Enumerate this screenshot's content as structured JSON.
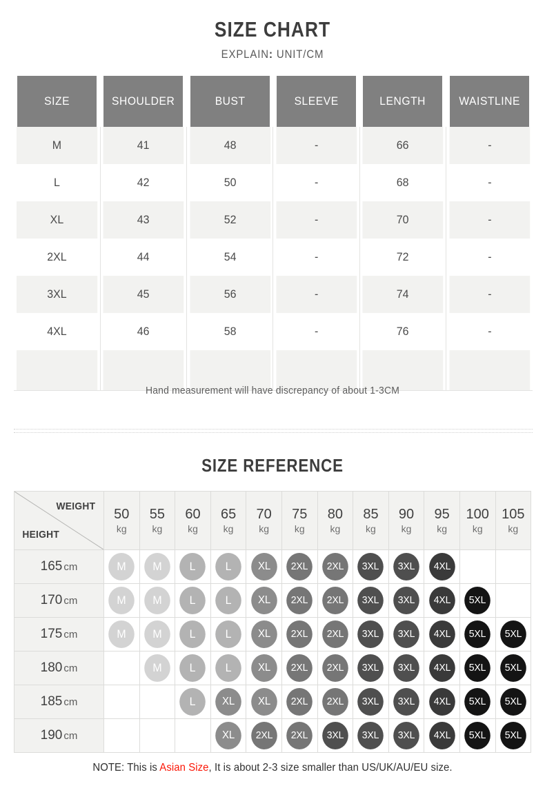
{
  "size_chart": {
    "title": "SIZE CHART",
    "subtitle_label": "EXPLAIN",
    "subtitle_colon": ":",
    "subtitle_value": "UNIT/CM",
    "columns": [
      "SIZE",
      "SHOULDER",
      "BUST",
      "SLEEVE",
      "LENGTH",
      "WAISTLINE"
    ],
    "rows": [
      {
        "size": "M",
        "shoulder": "41",
        "bust": "48",
        "sleeve": "-",
        "length": "66",
        "waistline": "-"
      },
      {
        "size": "L",
        "shoulder": "42",
        "bust": "50",
        "sleeve": "-",
        "length": "68",
        "waistline": "-"
      },
      {
        "size": "XL",
        "shoulder": "43",
        "bust": "52",
        "sleeve": "-",
        "length": "70",
        "waistline": "-"
      },
      {
        "size": "2XL",
        "shoulder": "44",
        "bust": "54",
        "sleeve": "-",
        "length": "72",
        "waistline": "-"
      },
      {
        "size": "3XL",
        "shoulder": "45",
        "bust": "56",
        "sleeve": "-",
        "length": "74",
        "waistline": "-"
      },
      {
        "size": "4XL",
        "shoulder": "46",
        "bust": "58",
        "sleeve": "-",
        "length": "76",
        "waistline": "-"
      },
      {
        "size": "",
        "shoulder": "",
        "bust": "",
        "sleeve": "",
        "length": "",
        "waistline": ""
      }
    ],
    "footnote": "Hand measurement will have discrepancy of about 1-3CM"
  },
  "size_reference": {
    "title": "SIZE REFERENCE",
    "corner": {
      "weight_label": "WEIGHT",
      "height_label": "HEIGHT"
    },
    "weight_unit": "kg",
    "height_unit": "cm",
    "weights": [
      "50",
      "55",
      "60",
      "65",
      "70",
      "75",
      "80",
      "85",
      "90",
      "95",
      "100",
      "105"
    ],
    "heights": [
      "165",
      "170",
      "175",
      "180",
      "185",
      "190"
    ],
    "matrix": [
      [
        "M",
        "M",
        "L",
        "L",
        "XL",
        "2XL",
        "2XL",
        "3XL",
        "3XL",
        "4XL",
        "",
        ""
      ],
      [
        "M",
        "M",
        "L",
        "L",
        "XL",
        "2XL",
        "2XL",
        "3XL",
        "3XL",
        "4XL",
        "5XL",
        ""
      ],
      [
        "M",
        "M",
        "L",
        "L",
        "XL",
        "2XL",
        "2XL",
        "3XL",
        "3XL",
        "4XL",
        "5XL",
        "5XL"
      ],
      [
        "",
        "M",
        "L",
        "L",
        "XL",
        "2XL",
        "2XL",
        "3XL",
        "3XL",
        "4XL",
        "5XL",
        "5XL"
      ],
      [
        "",
        "",
        "L",
        "XL",
        "XL",
        "2XL",
        "2XL",
        "3XL",
        "3XL",
        "4XL",
        "5XL",
        "5XL"
      ],
      [
        "",
        "",
        "",
        "XL",
        "2XL",
        "2XL",
        "3XL",
        "3XL",
        "3XL",
        "4XL",
        "5XL",
        "5XL"
      ]
    ]
  },
  "bottom_note": {
    "prefix": "NOTE: This is ",
    "highlight": "Asian Size",
    "suffix": ", It is about 2-3 size smaller than US/UK/AU/EU size."
  },
  "colors": {
    "header_bar": "#808080",
    "row_alt": "#f2f2f0",
    "highlight_red": "#fb1505",
    "bubble_M": "#d3d3d3",
    "bubble_L": "#b3b3b3",
    "bubble_XL": "#8c8c8c",
    "bubble_2XL": "#767676",
    "bubble_3XL": "#4f4f4f",
    "bubble_4XL": "#3a3a3a",
    "bubble_5XL": "#141414"
  }
}
